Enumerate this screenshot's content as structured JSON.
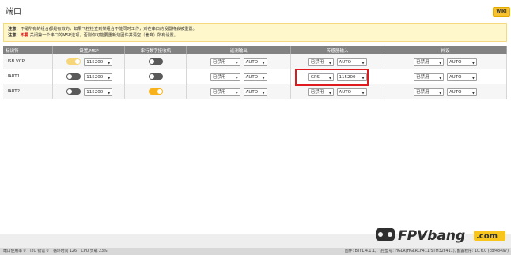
{
  "page": {
    "title": "端口",
    "wiki_label": "WIKI"
  },
  "notes": {
    "line1_label": "注意：",
    "line1_text": "不是所有的组合都是有效的，如果飞控检查到某组合不能同时工作，对在串口的设置将会被重置。",
    "line2_label": "注意：",
    "line2_warn": "不要",
    "line2_text": "关闭第一个串口的MSP选项，否则你可能要重新烧固件并清空（舍弃）所有设置。"
  },
  "table": {
    "headers": [
      "标识符",
      "设置/MSP",
      "串行数字接收机",
      "遥测输出",
      "传感器输入",
      "外设"
    ],
    "rows": [
      {
        "id": "USB VCP",
        "msp": "on-light",
        "baud": "115200",
        "rx": "off",
        "telemetry": "已禁用",
        "telemetry_baud": "AUTO",
        "sensor": "已禁用",
        "sensor_baud": "AUTO",
        "peripheral": "已禁用",
        "peripheral_baud": "AUTO"
      },
      {
        "id": "UART1",
        "msp": "off",
        "baud": "115200",
        "rx": "off",
        "telemetry": "已禁用",
        "telemetry_baud": "AUTO",
        "sensor": "GPS",
        "sensor_baud": "115200",
        "peripheral": "已禁用",
        "peripheral_baud": "AUTO"
      },
      {
        "id": "UART2",
        "msp": "off",
        "baud": "115200",
        "rx": "on",
        "telemetry": "已禁用",
        "telemetry_baud": "AUTO",
        "sensor": "已禁用",
        "sensor_baud": "AUTO",
        "peripheral": "已禁用",
        "peripheral_baud": "AUTO"
      }
    ]
  },
  "status": {
    "left1": "端口使用率 0",
    "left2": "I2C 错误 0",
    "left3": "循环时间 126",
    "left4": "CPU 负载 23%",
    "right": "固件: BTFL 4.1.1, 飞控型号: HGLR(HGLRCF411/STM32F411), 配置程序: 10.6.0 (cbf484a7)"
  },
  "logo": {
    "text": "FPVbang",
    "suffix": ".com"
  },
  "colors": {
    "accent": "#f8b21b",
    "header": "#828282",
    "notes_bg": "#fff7cc",
    "highlight": "#e0191f"
  }
}
